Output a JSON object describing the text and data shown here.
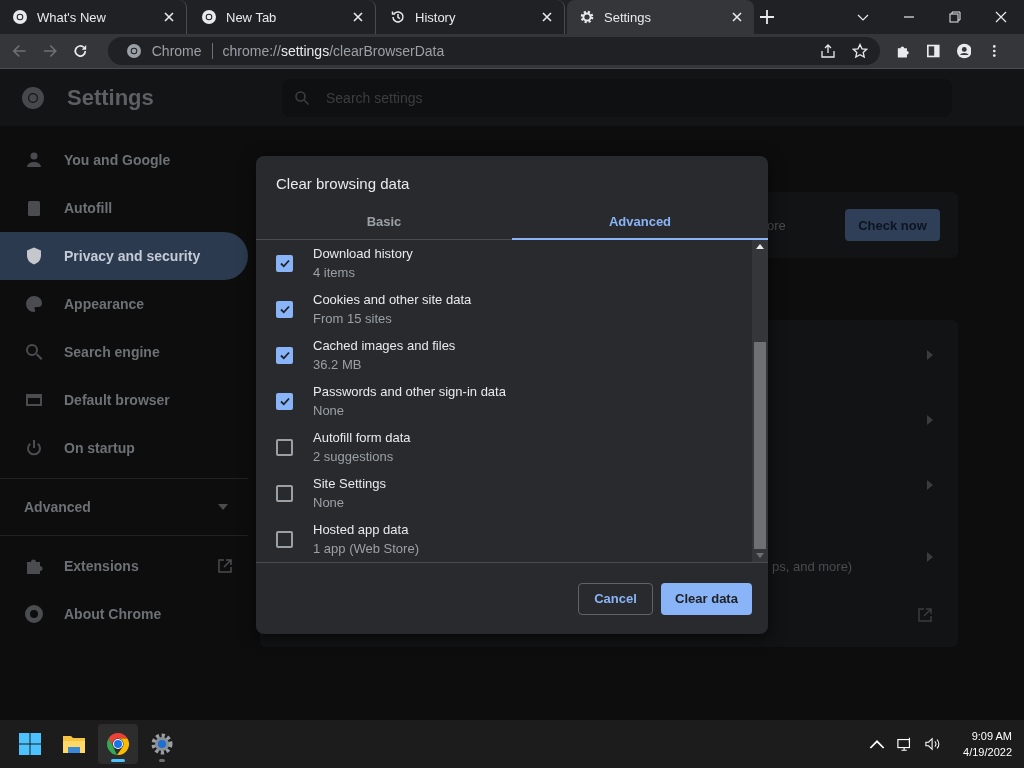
{
  "browser_tabs": [
    {
      "title": "What's New",
      "selected": false
    },
    {
      "title": "New Tab",
      "selected": false
    },
    {
      "title": "History",
      "selected": false
    },
    {
      "title": "Settings",
      "selected": true
    }
  ],
  "toolbar": {
    "site_label": "Chrome",
    "url": {
      "scheme": "chrome://",
      "host": "settings",
      "path": "/clearBrowserData"
    }
  },
  "settings": {
    "title": "Settings",
    "search": {
      "placeholder": "Search settings"
    }
  },
  "sidebar": {
    "items": [
      {
        "label": "You and Google",
        "selected": false
      },
      {
        "label": "Autofill",
        "selected": false
      },
      {
        "label": "Privacy and security",
        "selected": true
      },
      {
        "label": "Appearance",
        "selected": false
      },
      {
        "label": "Search engine",
        "selected": false
      },
      {
        "label": "Default browser",
        "selected": false
      },
      {
        "label": "On startup",
        "selected": false
      }
    ],
    "advanced": {
      "label": "Advanced",
      "expanded": false
    },
    "links": [
      {
        "label": "Extensions",
        "external": true
      },
      {
        "label": "About Chrome",
        "external": false
      }
    ]
  },
  "background": {
    "check_button": "Check now",
    "fragment_top": "ore",
    "fragment_bottom": "ps, and more)"
  },
  "dialog": {
    "title": "Clear browsing data",
    "tabs": [
      {
        "label": "Basic",
        "selected": false
      },
      {
        "label": "Advanced",
        "selected": true
      }
    ],
    "items": [
      {
        "label": "Download history",
        "detail": "4 items",
        "checked": true
      },
      {
        "label": "Cookies and other site data",
        "detail": "From 15 sites",
        "checked": true
      },
      {
        "label": "Cached images and files",
        "detail": "36.2 MB",
        "checked": true
      },
      {
        "label": "Passwords and other sign-in data",
        "detail": "None",
        "checked": true
      },
      {
        "label": "Autofill form data",
        "detail": "2 suggestions",
        "checked": false
      },
      {
        "label": "Site Settings",
        "detail": "None",
        "checked": false
      },
      {
        "label": "Hosted app data",
        "detail": "1 app (Web Store)",
        "checked": false
      }
    ],
    "cancel": "Cancel",
    "confirm": "Clear data"
  },
  "taskbar": {
    "apps": [
      {
        "kind": "start",
        "active": false
      },
      {
        "kind": "folder",
        "active": false
      },
      {
        "kind": "chrome",
        "active": true
      },
      {
        "kind": "gear",
        "active": false
      }
    ],
    "time": "9:09 AM",
    "date": "4/19/2022"
  }
}
